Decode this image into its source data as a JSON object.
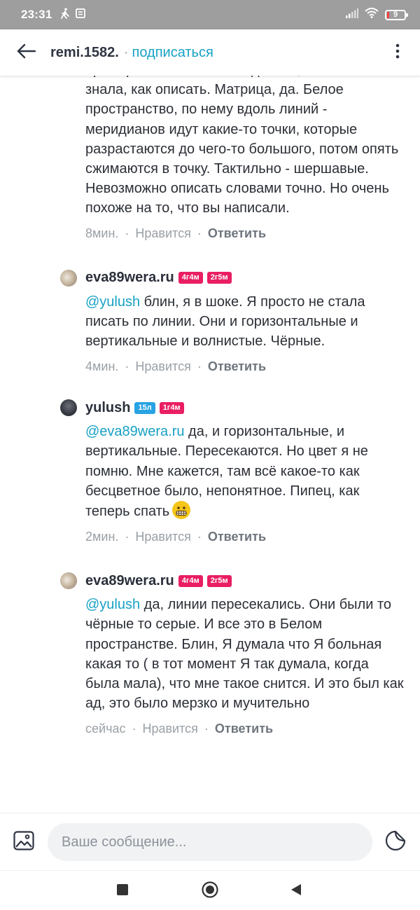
{
  "status_bar": {
    "time": "23:31",
    "battery": "9",
    "icons": [
      "walk-icon",
      "notification-icon",
      "signal-icon",
      "wifi-icon",
      "battery-icon"
    ]
  },
  "app_bar": {
    "title": "remi.1582.",
    "separator": "·",
    "subscribe_label": "подписаться",
    "back_icon": "arrow-left-icon",
    "menu_icon": "more-vertical-icon"
  },
  "comments": [
    {
      "author": "",
      "badges": [],
      "mention": "",
      "text": "примерно то же самое виделось, только я не знала, как описать. Матрица, да. Белое пространство, по нему вдоль линий - меридианов идут какие-то точки, которые разрастаются до чего-то большого, потом опять сжимаются в точку. Тактильно - шершавые. Невозможно описать словами точно. Но очень похоже на то, что вы написали.",
      "time": "8мин.",
      "like_label": "Нравится",
      "reply_label": "Ответить"
    },
    {
      "author": "eva89wera.ru",
      "badges": [
        "4г4м",
        "2г5м"
      ],
      "mention": "@yulush",
      "text": " блин, я в шоке. Я просто не стала писать по линии. Они и горизонтальные и вертикальные и волнистые. Чёрные.",
      "time": "4мин.",
      "like_label": "Нравится",
      "reply_label": "Ответить"
    },
    {
      "author": "yulush",
      "badges": [
        "15л",
        "1г4м"
      ],
      "mention": "@eva89wera.ru",
      "text": " да, и горизонтальные, и вертикальные. Пересекаются. Но цвет я не помню. Мне кажется, там всё какое-то как бесцветное было, непонятное. Пипец, как теперь спать",
      "emoji": "grimacing-face-emoji",
      "time": "2мин.",
      "like_label": "Нравится",
      "reply_label": "Ответить"
    },
    {
      "author": "eva89wera.ru",
      "badges": [
        "4г4м",
        "2г5м"
      ],
      "mention": "@yulush",
      "text": " да, линии пересекались. Они были то чёрные то серые. И все это в Белом пространстве. Блин, Я думала что Я больная какая то ( в тот момент Я так думала, когда была мала), что мне такое снится. И это был как ад, это было мерзко и мучительно",
      "time": "сейчас",
      "like_label": "Нравится",
      "reply_label": "Ответить"
    }
  ],
  "meta_separator": "·",
  "input_bar": {
    "placeholder": "Ваше сообщение...",
    "image_icon": "image-icon",
    "sticker_icon": "sticker-icon"
  },
  "nav_bar": {
    "buttons": [
      "recents-square-icon",
      "home-circle-icon",
      "back-triangle-icon"
    ]
  },
  "colors": {
    "accent": "#17a1c4",
    "badge_pink": "#e91e63",
    "badge_blue": "#29a3e3",
    "status_bar": "#9e9e9e"
  }
}
